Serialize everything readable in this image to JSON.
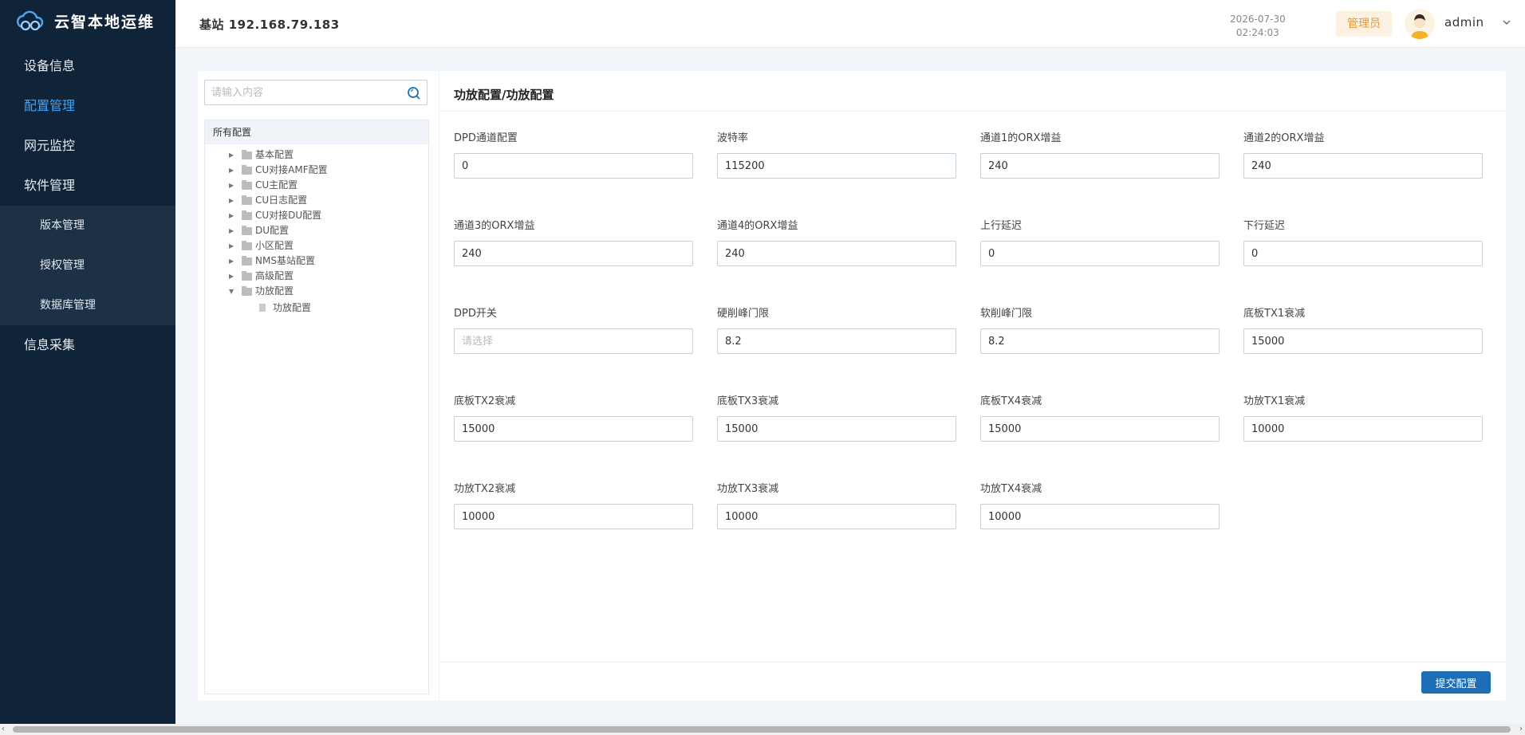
{
  "app": {
    "name": "云智本地运维"
  },
  "sidebar": {
    "items": [
      {
        "label": "设备信息"
      },
      {
        "label": "配置管理",
        "active": true
      },
      {
        "label": "网元监控"
      },
      {
        "label": "软件管理"
      }
    ],
    "sub_items": [
      {
        "label": "版本管理"
      },
      {
        "label": "授权管理"
      },
      {
        "label": "数据库管理"
      }
    ],
    "last_item": {
      "label": "信息采集"
    }
  },
  "header": {
    "station_label": "基站",
    "station_ip": "192.168.79.183",
    "date": "2026-07-30",
    "time": "02:24:03",
    "role": "管理员",
    "username": "admin"
  },
  "tree": {
    "search_placeholder": "请输入内容",
    "root": "所有配置",
    "nodes": [
      {
        "label": "基本配置",
        "expanded": false
      },
      {
        "label": "CU对接AMF配置",
        "expanded": false
      },
      {
        "label": "CU主配置",
        "expanded": false
      },
      {
        "label": "CU日志配置",
        "expanded": false
      },
      {
        "label": "CU对接DU配置",
        "expanded": false
      },
      {
        "label": "DU配置",
        "expanded": false
      },
      {
        "label": "小区配置",
        "expanded": false
      },
      {
        "label": "NMS基站配置",
        "expanded": false
      },
      {
        "label": "高级配置",
        "expanded": false
      },
      {
        "label": "功放配置",
        "expanded": true
      }
    ],
    "leaf": "功放配置"
  },
  "form": {
    "title": "功放配置/功放配置",
    "fields": [
      {
        "label": "DPD通道配置",
        "value": "0",
        "placeholder": ""
      },
      {
        "label": "波特率",
        "value": "115200",
        "placeholder": ""
      },
      {
        "label": "通道1的ORX增益",
        "value": "240",
        "placeholder": ""
      },
      {
        "label": "通道2的ORX增益",
        "value": "240",
        "placeholder": ""
      },
      {
        "label": "通道3的ORX增益",
        "value": "240",
        "placeholder": ""
      },
      {
        "label": "通道4的ORX增益",
        "value": "240",
        "placeholder": ""
      },
      {
        "label": "上行延迟",
        "value": "0",
        "placeholder": ""
      },
      {
        "label": "下行延迟",
        "value": "0",
        "placeholder": ""
      },
      {
        "label": "DPD开关",
        "value": "",
        "placeholder": "请选择"
      },
      {
        "label": "硬削峰门限",
        "value": "8.2",
        "placeholder": ""
      },
      {
        "label": "软削峰门限",
        "value": "8.2",
        "placeholder": ""
      },
      {
        "label": "底板TX1衰减",
        "value": "15000",
        "placeholder": ""
      },
      {
        "label": "底板TX2衰减",
        "value": "15000",
        "placeholder": ""
      },
      {
        "label": "底板TX3衰减",
        "value": "15000",
        "placeholder": ""
      },
      {
        "label": "底板TX4衰减",
        "value": "15000",
        "placeholder": ""
      },
      {
        "label": "功放TX1衰减",
        "value": "10000",
        "placeholder": ""
      },
      {
        "label": "功放TX2衰减",
        "value": "10000",
        "placeholder": ""
      },
      {
        "label": "功放TX3衰减",
        "value": "10000",
        "placeholder": ""
      },
      {
        "label": "功放TX4衰减",
        "value": "10000",
        "placeholder": ""
      }
    ],
    "submit_label": "提交配置"
  },
  "colors": {
    "sidebar_bg": "#0f2438",
    "active_nav": "#3ea5ff",
    "primary_button": "#1d6eb5",
    "role_badge_text": "#e6993a"
  }
}
